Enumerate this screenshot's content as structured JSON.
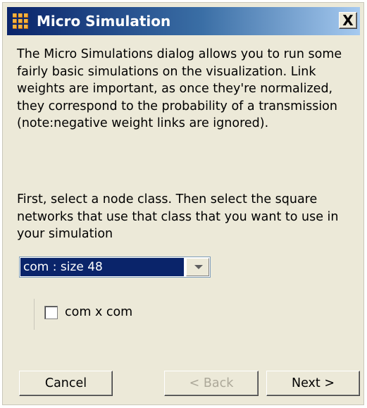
{
  "window": {
    "title": "Micro Simulation",
    "close_glyph": "X"
  },
  "dialog": {
    "description": "The Micro Simulations dialog allows you to run some fairly basic simulations on the visualization. Link weights are important, as once they're normalized, they correspond to the probability of a transmission (note:negative weight links are ignored).",
    "instruction": "First, select a node class. Then select the square networks that use that class that you want to use in your simulation"
  },
  "node_class_select": {
    "selected": "com : size 48"
  },
  "networks": [
    {
      "label": "com x com",
      "checked": false
    }
  ],
  "buttons": {
    "cancel": "Cancel",
    "back": "< Back",
    "next": "Next >"
  },
  "colors": {
    "title_gradient_start": "#0a246a",
    "title_gradient_end": "#a6caf0",
    "dialog_bg": "#ece9d8",
    "selection_bg": "#0a246a",
    "disabled_text": "#aca899"
  },
  "icons": {
    "title_icon": "grid-app-icon",
    "close": "close-icon",
    "dropdown": "chevron-down-icon"
  }
}
